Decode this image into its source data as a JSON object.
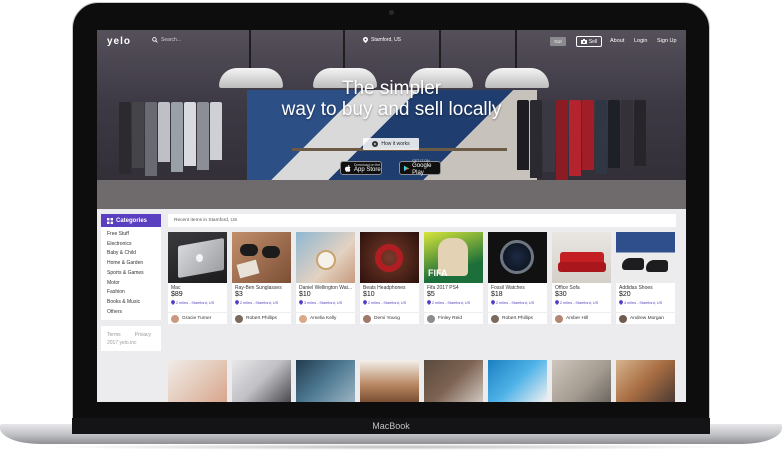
{
  "device": {
    "label": "MacBook"
  },
  "nav": {
    "logo": "yelo",
    "search_placeholder": "Search...",
    "location": "Stamford, US",
    "go_label": "Go!",
    "sell_label": "Sell",
    "links": [
      "About",
      "Login",
      "Sign Up"
    ]
  },
  "hero": {
    "line1": "The simpler",
    "line2": "way to buy and sell locally",
    "how_label": "How it works",
    "appstore_small": "Download on the",
    "appstore_big": "App Store",
    "googleplay_small": "GET IT ON",
    "googleplay_big": "Google Play"
  },
  "sidebar": {
    "header": "Categories",
    "items": [
      "Free Stuff",
      "Electronics",
      "Baby & Child",
      "Home & Garden",
      "Sports & Games",
      "Motor",
      "Fashion",
      "Books & Music",
      "Others"
    ],
    "footer_terms": "Terms",
    "footer_privacy": "Privacy",
    "footer_copy": "2017 yelo.inc"
  },
  "recent_label": "Recent items in Stamford, US",
  "items": [
    {
      "title": "Mac",
      "price": "$89",
      "location": "2 miles - Stamford, US",
      "user": "Gracie Turner",
      "avatar_color": "#c99a7e",
      "thumb": "mac"
    },
    {
      "title": "Ray-Ben Sunglasses",
      "price": "$3",
      "location": "2 miles - Stamford, US",
      "user": "Robert Phillips",
      "avatar_color": "#7b6a5e",
      "thumb": "sunglasses"
    },
    {
      "title": "Daniel Wellington Wat...",
      "price": "$10",
      "location": "3 miles - Stamford, US",
      "user": "Amelia Kelly",
      "avatar_color": "#d9a98a",
      "thumb": "watch-wrist"
    },
    {
      "title": "Beats Headphones",
      "price": "$10",
      "location": "2 miles - Stamford, US",
      "user": "Demi Young",
      "avatar_color": "#a1786a",
      "thumb": "headphones"
    },
    {
      "title": "Fifa 2017 PS4",
      "price": "$5",
      "location": "2 miles - Stamford, US",
      "user": "Finley Reid",
      "avatar_color": "#8d8d8d",
      "thumb": "fifa"
    },
    {
      "title": "Fossil Watches",
      "price": "$18",
      "location": "2 miles - Stamford, US",
      "user": "Robert Phillips",
      "avatar_color": "#7b6a5e",
      "thumb": "fossil"
    },
    {
      "title": "Office Sofa",
      "price": "$30",
      "location": "2 miles - Stamford, US",
      "user": "Amber Hill",
      "avatar_color": "#b48774",
      "thumb": "sofa"
    },
    {
      "title": "Addidas Shoes",
      "price": "$20",
      "location": "4 miles - Stamford, US",
      "user": "Andrew Morgan",
      "avatar_color": "#6f5b52",
      "thumb": "shoes"
    }
  ],
  "colors": {
    "accent": "#5a3fc0",
    "screen_bg": "#ececee"
  }
}
